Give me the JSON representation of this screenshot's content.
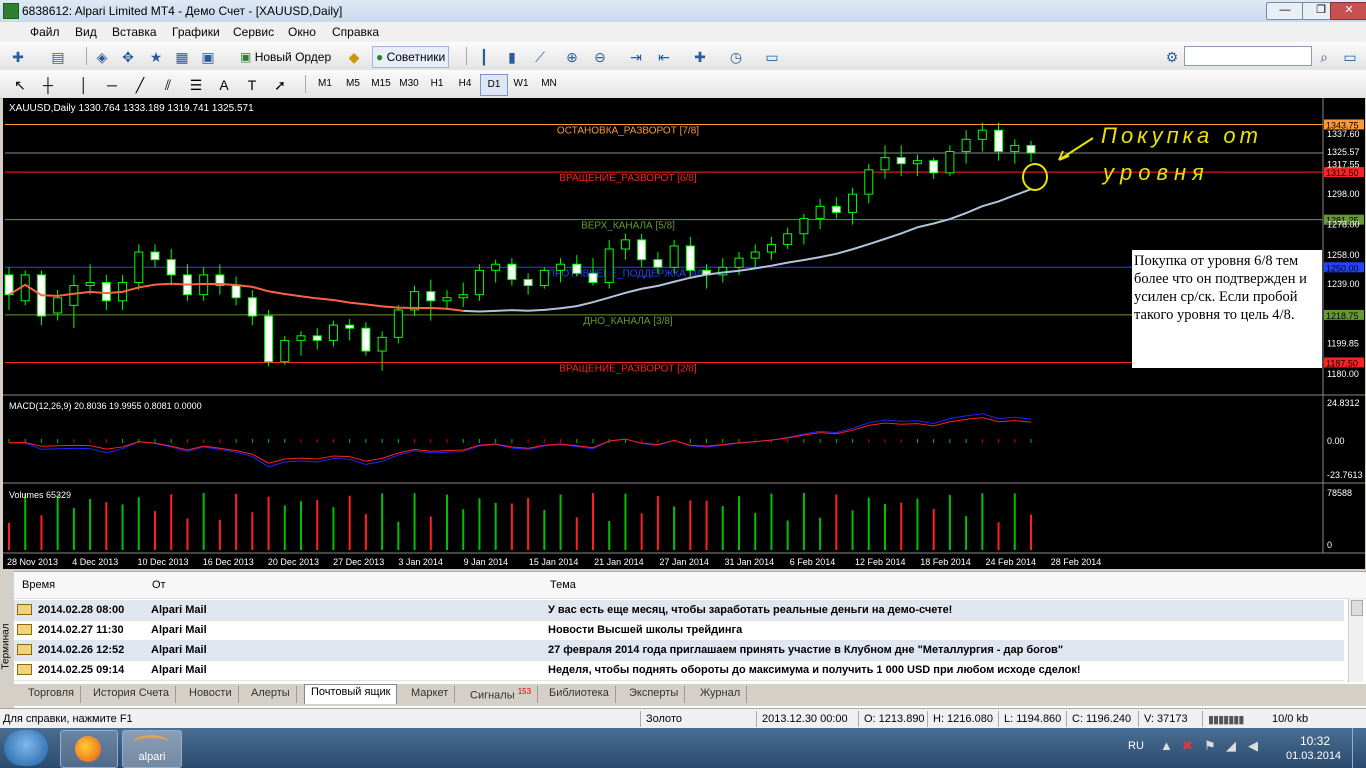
{
  "window": {
    "title": "6838612: Alpari Limited MT4 - Демо Счет - [XAUUSD,Daily]",
    "buttons": [
      "—",
      "❐",
      "✕"
    ]
  },
  "menu": [
    "Файл",
    "Вид",
    "Вставка",
    "Графики",
    "Сервис",
    "Окно",
    "Справка"
  ],
  "toolbar1": {
    "new_order": "Новый Ордер",
    "experts": "Советники"
  },
  "timeframes": [
    "M1",
    "M5",
    "M15",
    "M30",
    "H1",
    "H4",
    "D1",
    "W1",
    "MN"
  ],
  "active_timeframe": "D1",
  "chart": {
    "header": "XAUUSD,Daily  1330.764 1333.189 1319.741 1325.571",
    "levels": [
      {
        "label": "ОСТАНОВКА_РАЗВОРОТ [7/8]",
        "price": "1343.75",
        "color": "#ff9933"
      },
      {
        "label": "ВРАЩЕНИЕ_РАЗВОРОТ [6/8]",
        "price": "1312.50",
        "color": "#ff2222"
      },
      {
        "label": "ВЕРХ_КАНАЛА [5/8]",
        "price": "1281.25",
        "color": "#669933"
      },
      {
        "label": "ПРОТИВНЕИЕ_ПОДДЕРЖКА [4/8]",
        "price": "1250.00",
        "color": "#2244ff"
      },
      {
        "label": "ДНО_КАНАЛА [3/8]",
        "price": "1218.75",
        "color": "#669933"
      },
      {
        "label": "ВРАЩЕНИЕ_РАЗВОРОТ [2/8]",
        "price": "1187.50",
        "color": "#ff2222"
      }
    ],
    "price_ticks": [
      "1337.60",
      "1325.57",
      "1317.55",
      "1298.00",
      "1278.00",
      "1258.00",
      "1239.00",
      "1199.85",
      "1180.00"
    ],
    "date_ticks": [
      "28 Nov 2013",
      "4 Dec 2013",
      "10 Dec 2013",
      "16 Dec 2013",
      "20 Dec 2013",
      "27 Dec 2013",
      "3 Jan 2014",
      "9 Jan 2014",
      "15 Jan 2014",
      "21 Jan 2014",
      "27 Jan 2014",
      "31 Jan 2014",
      "6 Feb 2014",
      "12 Feb 2014",
      "18 Feb 2014",
      "24 Feb 2014",
      "28 Feb 2014"
    ],
    "annotation": "Покупка от уровня 6/8 тем более что он подтвержден и усилен ср/ск. Если пробой такого уровня то цель 4/8.",
    "handwriting": [
      "Покупка от",
      "уровня"
    ],
    "macd_label": "MACD(12,26,9) 20.8036 19.9955 0.8081 0.0000",
    "macd_ticks": [
      "24.8312",
      "0.00",
      "-23.7613"
    ],
    "volume_label": "Volumes 65329",
    "volume_ticks": [
      "78588",
      "0"
    ]
  },
  "chart_data": {
    "type": "candlestick",
    "title": "XAUUSD,Daily",
    "ohlc": [
      [
        1245,
        1250,
        1222,
        1232
      ],
      [
        1228,
        1248,
        1225,
        1245
      ],
      [
        1245,
        1248,
        1212,
        1218
      ],
      [
        1220,
        1235,
        1215,
        1230
      ],
      [
        1225,
        1245,
        1210,
        1238
      ],
      [
        1238,
        1252,
        1232,
        1240
      ],
      [
        1240,
        1245,
        1222,
        1228
      ],
      [
        1228,
        1245,
        1222,
        1240
      ],
      [
        1240,
        1265,
        1235,
        1260
      ],
      [
        1260,
        1265,
        1250,
        1255
      ],
      [
        1255,
        1262,
        1238,
        1245
      ],
      [
        1245,
        1252,
        1228,
        1232
      ],
      [
        1232,
        1250,
        1228,
        1245
      ],
      [
        1245,
        1252,
        1232,
        1238
      ],
      [
        1238,
        1244,
        1225,
        1230
      ],
      [
        1230,
        1235,
        1212,
        1218
      ],
      [
        1218,
        1222,
        1185,
        1188
      ],
      [
        1188,
        1205,
        1186,
        1202
      ],
      [
        1202,
        1208,
        1192,
        1205
      ],
      [
        1205,
        1210,
        1196,
        1202
      ],
      [
        1202,
        1215,
        1198,
        1212
      ],
      [
        1212,
        1216,
        1202,
        1210
      ],
      [
        1210,
        1214,
        1192,
        1195
      ],
      [
        1195,
        1208,
        1182,
        1204
      ],
      [
        1204,
        1225,
        1200,
        1222
      ],
      [
        1222,
        1238,
        1218,
        1234
      ],
      [
        1234,
        1242,
        1215,
        1228
      ],
      [
        1228,
        1235,
        1222,
        1230
      ],
      [
        1230,
        1240,
        1224,
        1232
      ],
      [
        1232,
        1252,
        1228,
        1248
      ],
      [
        1248,
        1255,
        1240,
        1252
      ],
      [
        1252,
        1256,
        1238,
        1242
      ],
      [
        1242,
        1246,
        1232,
        1238
      ],
      [
        1238,
        1250,
        1236,
        1248
      ],
      [
        1248,
        1256,
        1240,
        1252
      ],
      [
        1252,
        1258,
        1244,
        1246
      ],
      [
        1246,
        1256,
        1238,
        1240
      ],
      [
        1240,
        1268,
        1236,
        1262
      ],
      [
        1262,
        1272,
        1255,
        1268
      ],
      [
        1268,
        1272,
        1250,
        1255
      ],
      [
        1255,
        1260,
        1246,
        1250
      ],
      [
        1250,
        1268,
        1246,
        1264
      ],
      [
        1264,
        1270,
        1244,
        1248
      ],
      [
        1248,
        1252,
        1236,
        1245
      ],
      [
        1245,
        1256,
        1240,
        1250
      ],
      [
        1250,
        1260,
        1245,
        1256
      ],
      [
        1256,
        1265,
        1250,
        1260
      ],
      [
        1260,
        1270,
        1255,
        1265
      ],
      [
        1265,
        1276,
        1262,
        1272
      ],
      [
        1272,
        1285,
        1265,
        1282
      ],
      [
        1282,
        1295,
        1275,
        1290
      ],
      [
        1290,
        1296,
        1282,
        1286
      ],
      [
        1286,
        1302,
        1278,
        1298
      ],
      [
        1298,
        1318,
        1292,
        1314
      ],
      [
        1314,
        1330,
        1308,
        1322
      ],
      [
        1322,
        1330,
        1310,
        1318
      ],
      [
        1318,
        1324,
        1310,
        1320
      ],
      [
        1320,
        1322,
        1308,
        1312
      ],
      [
        1312,
        1330,
        1310,
        1326
      ],
      [
        1326,
        1340,
        1318,
        1334
      ],
      [
        1334,
        1345,
        1326,
        1340
      ],
      [
        1340,
        1345,
        1320,
        1326
      ],
      [
        1326,
        1334,
        1318,
        1330
      ],
      [
        1330,
        1333,
        1319,
        1325
      ]
    ],
    "ma_label": "",
    "macd": {
      "label": "MACD(12,26,9)",
      "main": 20.8036,
      "signal": 19.9955
    },
    "volumes_last": 65329
  },
  "terminal": {
    "columns": [
      "Время",
      "От",
      "Тема"
    ],
    "rows": [
      {
        "time": "2014.02.28 08:00",
        "from": "Alpari Mail",
        "subject": "У вас есть еще месяц, чтобы заработать реальные деньги на демо-счете!"
      },
      {
        "time": "2014.02.27 11:30",
        "from": "Alpari Mail",
        "subject": "Новости Высшей школы трейдинга"
      },
      {
        "time": "2014.02.26 12:52",
        "from": "Alpari Mail",
        "subject": "27 февраля 2014 года приглашаем принять участие в Клубном дне \"Металлургия - дар богов\""
      },
      {
        "time": "2014.02.25 09:14",
        "from": "Alpari Mail",
        "subject": "Неделя, чтобы поднять обороты до максимума и получить 1 000 USD при любом исходе сделок!"
      }
    ],
    "side_label": "Терминал",
    "tabs": [
      "Торговля",
      "История Счета",
      "Новости",
      "Алерты",
      "Почтовый ящик",
      "Маркет",
      "Сигналы",
      "Библиотека",
      "Эксперты",
      "Журнал"
    ],
    "signals_badge": "153",
    "active_tab": "Почтовый ящик"
  },
  "status": {
    "help": "Для справки, нажмите F1",
    "profile": "Золото",
    "datetime": "2013.12.30 00:00",
    "open": "O: 1213.890",
    "high": "H: 1216.080",
    "low": "L: 1194.860",
    "close": "C: 1196.240",
    "volume": "V: 37173",
    "traffic": "10/0 kb"
  },
  "taskbar": {
    "app": "alpari",
    "lang": "RU",
    "time": "10:32",
    "date": "01.03.2014"
  }
}
